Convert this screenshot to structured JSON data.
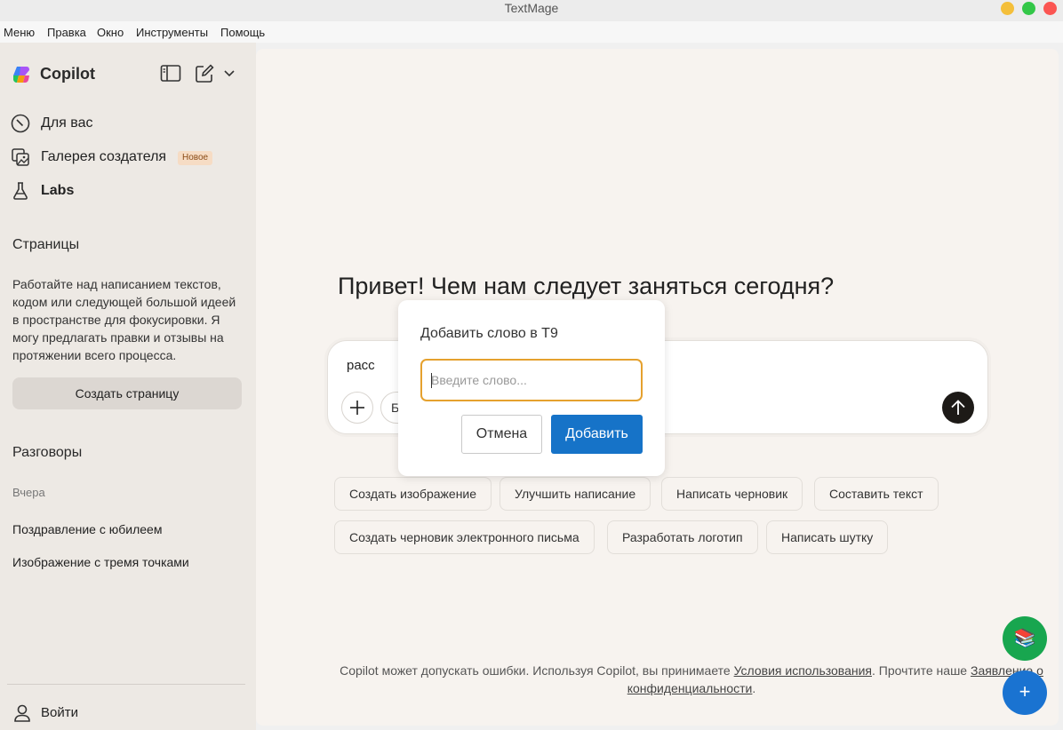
{
  "window": {
    "title": "TextMage"
  },
  "menubar": [
    "Меню",
    "Правка",
    "Окно",
    "Инструменты",
    "Помощь"
  ],
  "sidebar": {
    "brand": "Copilot",
    "nav": [
      {
        "label": "Для вас",
        "icon": "compass-icon"
      },
      {
        "label": "Галерея создателя",
        "icon": "gallery-icon",
        "badge": "Новое"
      },
      {
        "label": "Labs",
        "icon": "flask-icon"
      }
    ],
    "pages": {
      "title": "Страницы",
      "description": "Работайте над написанием текстов, кодом или следующей большой идеей в пространстве для фокусировки. Я могу предлагать правки и отзывы на протяжении всего процесса.",
      "create_button": "Создать страницу"
    },
    "conversations": {
      "title": "Разговоры",
      "group": "Вчера",
      "items": [
        "Поздравление с юбилеем",
        "Изображение с тремя точками"
      ]
    },
    "signin": "Войти"
  },
  "main": {
    "greeting": "Привет! Чем нам следует заняться сегодня?",
    "composer_text": "расс",
    "mode_label": "Б",
    "chips": [
      "Создать изображение",
      "Улучшить написание",
      "Написать черновик",
      "Составить текст",
      "Создать черновик электронного письма",
      "Разработать логотип",
      "Написать шутку"
    ],
    "footer": {
      "part1": "Copilot может допускать ошибки. Используя Copilot, вы принимаете ",
      "terms_link": "Условия использования",
      "part2": ". Прочтите нашe ",
      "privacy_link": "Заявление о конфиденциальности",
      "part3": "."
    }
  },
  "dialog": {
    "title": "Добавить слово в Т9",
    "placeholder": "Введите слово...",
    "cancel": "Отмена",
    "add": "Добавить"
  },
  "fabs": {
    "books": "📚",
    "plus": "+"
  },
  "colors": {
    "accent": "#1673c8",
    "input_focus": "#e5a12e",
    "fab_green": "#18a64f",
    "fab_blue": "#1a73d1"
  }
}
